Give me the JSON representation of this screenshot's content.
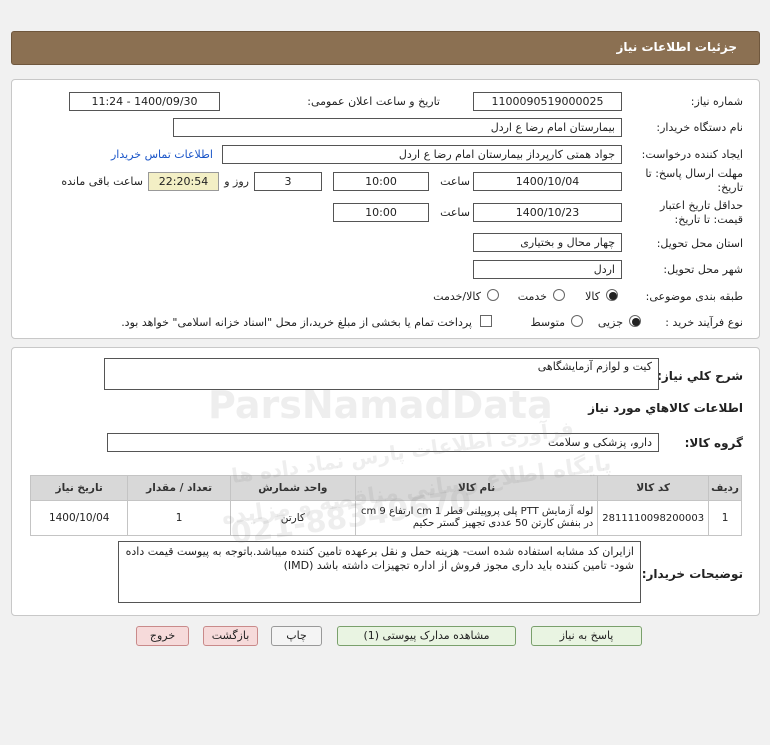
{
  "header": {
    "title": "جزئیات اطلاعات نیاز"
  },
  "form": {
    "need_number_label": "شماره نیاز:",
    "need_number": "1100090519000025",
    "announce_label": "تاریخ و ساعت اعلان عمومی:",
    "announce_value": "1400/09/30 - 11:24",
    "buyer_org_label": "نام دستگاه خریدار:",
    "buyer_org": "بیمارستان امام رضا  ع  اردل",
    "creator_label": "ایجاد کننده درخواست:",
    "creator": "جواد همتی کارپرداز بیمارستان امام رضا  ع  اردل",
    "contact_link": "اطلاعات تماس خریدار",
    "reply_deadline_label": "مهلت ارسال پاسخ: تا تاریخ:",
    "reply_date": "1400/10/04",
    "time_label": "ساعت",
    "reply_time": "10:00",
    "days_value": "3",
    "days_label": "روز و",
    "remaining_time": "22:20:54",
    "remaining_label": "ساعت باقی مانده",
    "validity_label": "حداقل تاریخ اعتبار قیمت: تا تاریخ:",
    "validity_date": "1400/10/23",
    "validity_time": "10:00",
    "delivery_province_label": "استان محل تحویل:",
    "delivery_province": "چهار محال و بختیاری",
    "delivery_city_label": "شهر محل تحویل:",
    "delivery_city": "اردل",
    "category_label": "طبقه بندی موضوعی:",
    "category_options": [
      "کالا",
      "خدمت",
      "کالا/خدمت"
    ],
    "process_label": "نوع فرآیند خرید :",
    "process_options": [
      "جزیی",
      "متوسط"
    ],
    "payment_note": "پرداخت تمام یا بخشی از مبلغ خرید،از محل \"اسناد خزانه اسلامی\" خواهد بود."
  },
  "details": {
    "general_desc_label": "شرح کلي نياز:",
    "general_desc": "کیت و لوازم آزمایشگاهی",
    "goods_info_title": "اطلاعات کالاهاي مورد نياز",
    "goods_group_label": "گروه کالا:",
    "goods_group": "دارو، پزشکی و سلامت",
    "table": {
      "headers": [
        "ردیف",
        "کد کالا",
        "نام کالا",
        "واحد شمارش",
        "تعداد / مقدار",
        "تاریخ نیاز"
      ],
      "rows": [
        {
          "row": "1",
          "code": "2811110098200003",
          "name": "لوله آزمایش PTT پلی پروپیلنی قطر 1 cm ارتفاع 9 cm در بنفش کارتن 50 عددی تجهیز گستر حکیم",
          "unit": "کارتن",
          "qty": "1",
          "date": "1400/10/04"
        }
      ]
    },
    "buyer_notes_label": "توضیحات خریدار:",
    "buyer_notes": "ازایران کد مشابه استفاده شده است- هزینه حمل و نقل برعهده تامین کننده میباشد.باتوجه به پیوست قیمت داده شود- تامین کننده باید داری مجوز فروش از اداره تجهیزات داشته باشد (IMD)"
  },
  "buttons": {
    "reply": "پاسخ به نیاز",
    "view_docs": "مشاهده مدارک پیوستی (1)",
    "print": "چاپ",
    "back": "بازگشت",
    "exit": "خروج"
  },
  "watermark": {
    "brand": "ParsNamadData",
    "line1": "پایگاه اطلاع رسانی مناقصه و مزایده",
    "line2": "فرآوری اطلاعات پارس نماد داده ها",
    "phone": "021-88349670"
  },
  "colors": {
    "header_bg": "#8b7052",
    "link": "#1a55c8",
    "remaining_bg": "#f3efc5",
    "button_green_bg": "#e9f4e2",
    "button_red_bg": "#f6dada"
  }
}
